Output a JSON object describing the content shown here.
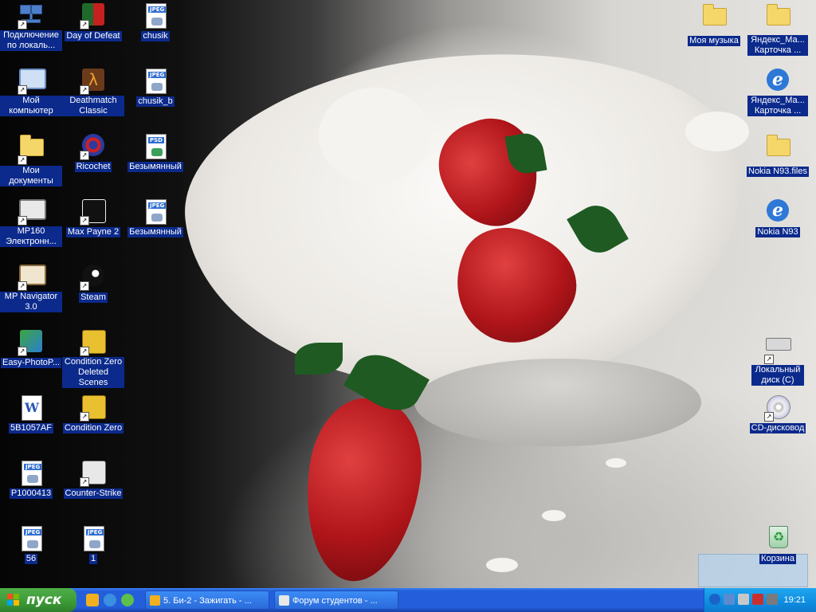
{
  "desktop": {
    "icons_left_col1": [
      {
        "label": "Подключение по локаль...",
        "icon": "network-connection-icon"
      },
      {
        "label": "Мой компьютер",
        "icon": "my-computer-icon"
      },
      {
        "label": "Мои документы",
        "icon": "my-documents-icon"
      },
      {
        "label": "MP160 Электронн...",
        "icon": "printer-manual-icon"
      },
      {
        "label": "MP Navigator 3.0",
        "icon": "scanner-app-icon"
      },
      {
        "label": "Easy-PhotoP...",
        "icon": "photo-print-icon"
      },
      {
        "label": "5B1057AF",
        "icon": "word-document-icon"
      },
      {
        "label": "P1000413",
        "icon": "jpeg-file-icon"
      },
      {
        "label": "56",
        "icon": "jpeg-file-icon"
      }
    ],
    "icons_left_col2": [
      {
        "label": "Day of Defeat",
        "icon": "game-icon"
      },
      {
        "label": "Deathmatch Classic",
        "icon": "game-icon"
      },
      {
        "label": "Ricochet",
        "icon": "game-icon"
      },
      {
        "label": "Max Payne 2",
        "icon": "game-icon"
      },
      {
        "label": "Steam",
        "icon": "steam-icon"
      },
      {
        "label": "Condition Zero Deleted Scenes",
        "icon": "game-icon"
      },
      {
        "label": "Condition Zero",
        "icon": "game-icon"
      },
      {
        "label": "Counter-Strike",
        "icon": "game-icon"
      },
      {
        "label": "1",
        "icon": "jpeg-file-icon"
      }
    ],
    "icons_left_col3": [
      {
        "label": "chusik",
        "icon": "jpeg-file-icon"
      },
      {
        "label": "chusik_b",
        "icon": "jpeg-file-icon"
      },
      {
        "label": "Безымянный",
        "icon": "psd-file-icon"
      },
      {
        "label": "Безымянный",
        "icon": "jpeg-file-icon"
      }
    ],
    "icons_right": [
      {
        "label": "Моя музыка",
        "icon": "folder-icon"
      },
      {
        "label": "Яндекс_Ма... Карточка ...",
        "icon": "folder-icon"
      },
      {
        "label": "Яндекс_Ма... Карточка ...",
        "icon": "internet-explorer-icon"
      },
      {
        "label": "Nokia N93.files",
        "icon": "folder-icon"
      },
      {
        "label": "Nokia N93",
        "icon": "internet-explorer-icon"
      },
      {
        "label": "Локальный диск (C)",
        "icon": "hard-drive-icon"
      },
      {
        "label": "CD-дисковод",
        "icon": "cd-drive-icon"
      },
      {
        "label": "Корзина",
        "icon": "recycle-bin-icon"
      }
    ],
    "tags": {
      "jpeg": "JPEG",
      "psd": "PSD"
    }
  },
  "taskbar": {
    "start_label": "пуск",
    "tasks": [
      {
        "label": "5. Би-2 - Зажигать - ..."
      },
      {
        "label": "Форум студентов - ..."
      }
    ],
    "clock": "19:21"
  },
  "colors": {
    "label_bg": "#0b2a8c",
    "taskbar_blue": "#245edb",
    "start_green": "#3c9a36",
    "tray_blue": "#0f8de0"
  }
}
